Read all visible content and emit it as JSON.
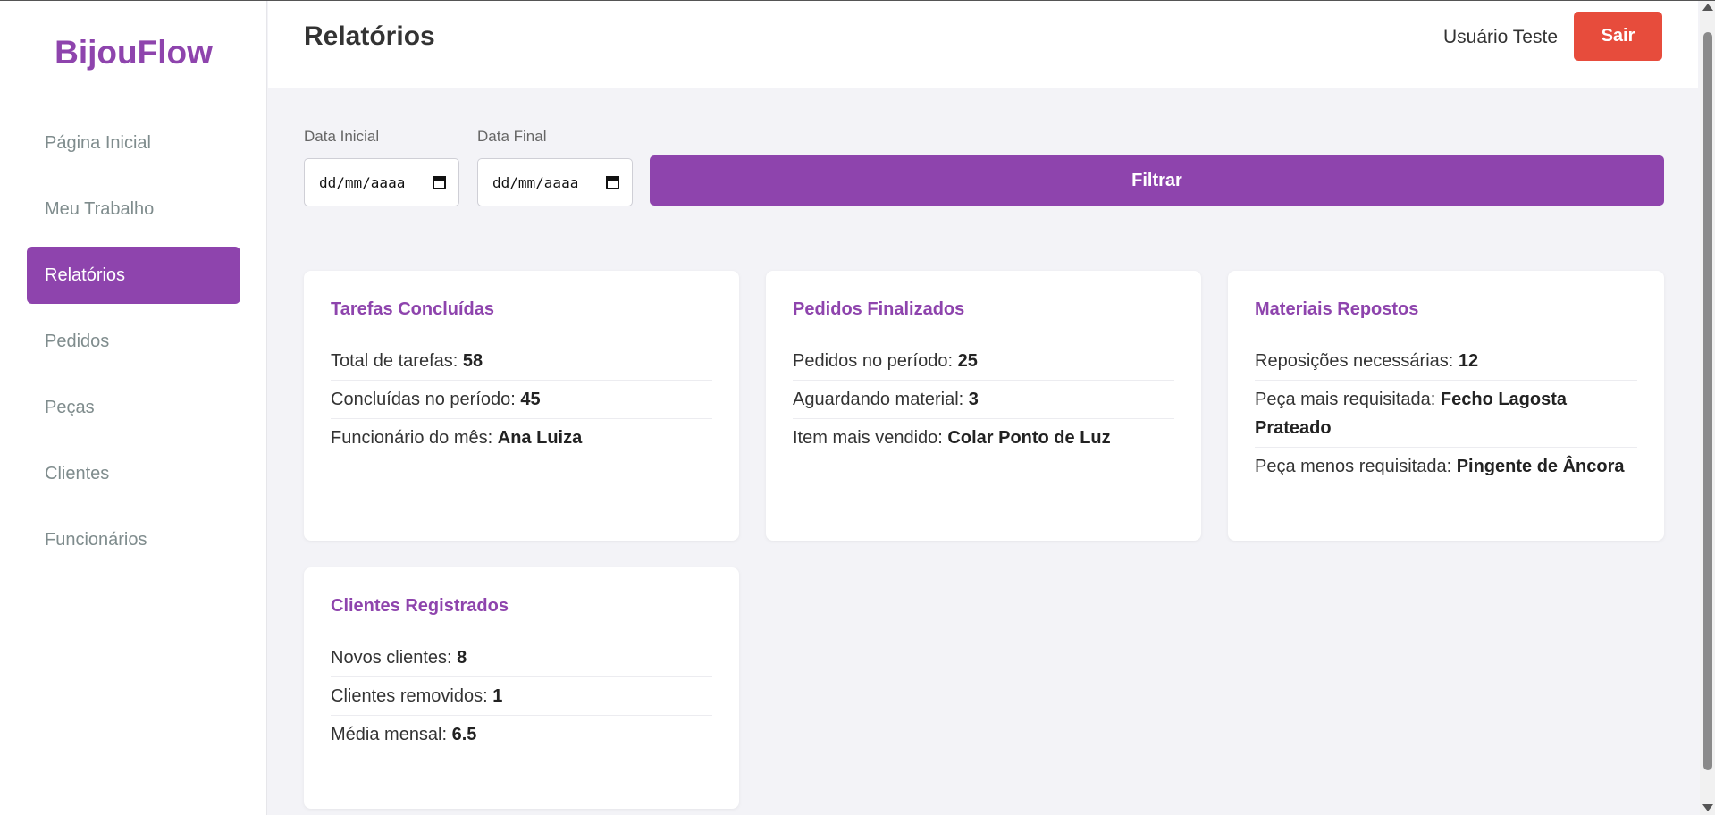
{
  "app": {
    "brand": "BijouFlow"
  },
  "sidebar": {
    "items": [
      {
        "label": "Página Inicial"
      },
      {
        "label": "Meu Trabalho"
      },
      {
        "label": "Relatórios"
      },
      {
        "label": "Pedidos"
      },
      {
        "label": "Peças"
      },
      {
        "label": "Clientes"
      },
      {
        "label": "Funcionários"
      }
    ]
  },
  "header": {
    "title": "Relatórios",
    "user": "Usuário Teste",
    "logout_label": "Sair"
  },
  "filters": {
    "start_label": "Data Inicial",
    "start_value": "dd/mm/aaaa",
    "end_label": "Data Final",
    "end_value": "dd/mm/aaaa",
    "button_label": "Filtrar"
  },
  "cards": {
    "tarefas": {
      "title": "Tarefas Concluídas",
      "lines": [
        {
          "label": "Total de tarefas: ",
          "value": "58"
        },
        {
          "label": "Concluídas no período: ",
          "value": "45"
        },
        {
          "label": "Funcionário do mês: ",
          "value": "Ana Luiza"
        }
      ]
    },
    "pedidos": {
      "title": "Pedidos Finalizados",
      "lines": [
        {
          "label": "Pedidos no período: ",
          "value": "25"
        },
        {
          "label": "Aguardando material: ",
          "value": "3"
        },
        {
          "label": "Item mais vendido: ",
          "value": "Colar Ponto de Luz"
        }
      ]
    },
    "materiais": {
      "title": "Materiais Repostos",
      "lines": [
        {
          "label": "Reposições necessárias: ",
          "value": "12"
        },
        {
          "label": "Peça mais requisitada: ",
          "value": "Fecho Lagosta Prateado"
        },
        {
          "label": "Peça menos requisitada: ",
          "value": "Pingente de Âncora"
        }
      ]
    },
    "clientes": {
      "title": "Clientes Registrados",
      "lines": [
        {
          "label": "Novos clientes: ",
          "value": "8"
        },
        {
          "label": "Clientes removidos: ",
          "value": "1"
        },
        {
          "label": "Média mensal: ",
          "value": "6.5"
        }
      ]
    }
  },
  "colors": {
    "accent": "#8e44ad",
    "danger": "#e74c3c",
    "background": "#f3f3f7"
  }
}
